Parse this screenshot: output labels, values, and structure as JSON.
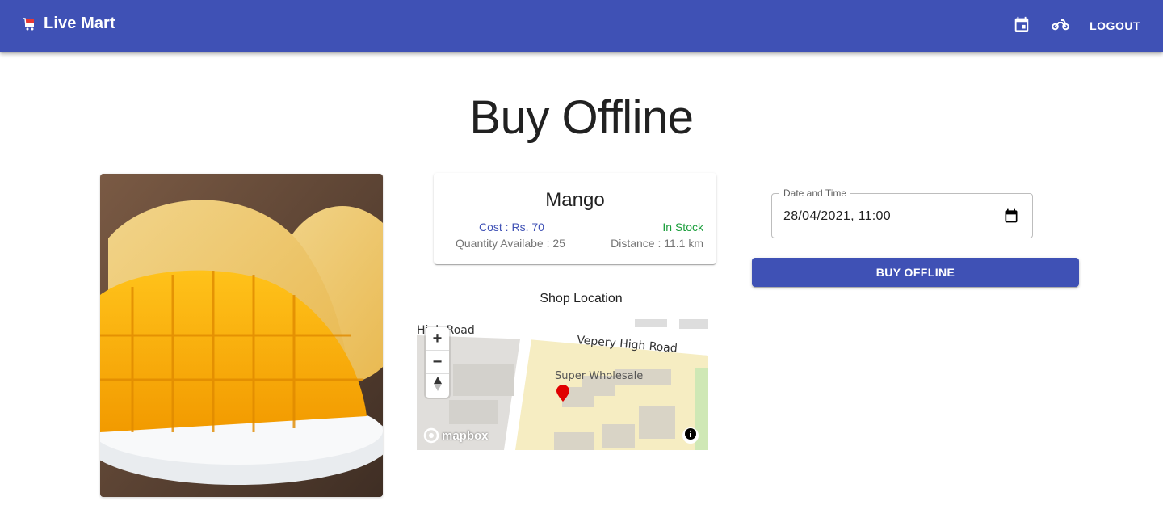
{
  "appbar": {
    "title": "Live Mart",
    "logout_label": "LOGOUT"
  },
  "page": {
    "title": "Buy Offline"
  },
  "product": {
    "name": "Mango",
    "cost": "Cost : Rs. 70",
    "stock_status": "In Stock",
    "quantity": "Quantity Availabe : 25",
    "distance": "Distance : 11.1 km"
  },
  "shop_location": {
    "label": "Shop Location",
    "map": {
      "road_1": "High Road",
      "road_2": "Vepery High Road",
      "place": "Super Wholesale",
      "attribution_logo": "mapbox",
      "zoom_in": "+",
      "zoom_out": "−"
    }
  },
  "form": {
    "date_label": "Date and Time",
    "date_value": "28/04/2021, 11:00",
    "buy_label": "BUY OFFLINE"
  },
  "colors": {
    "primary": "#3f51b5",
    "in_stock": "#1a9e3b"
  }
}
